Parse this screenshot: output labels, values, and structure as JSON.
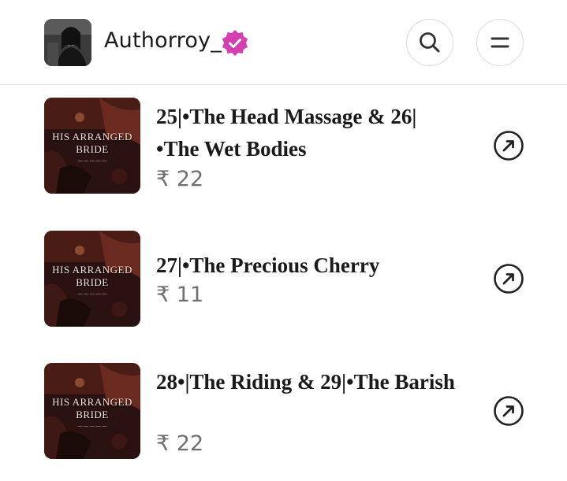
{
  "header": {
    "username": "Authorroy_",
    "verified_icon": "verified-badge-icon",
    "search_icon": "search-icon",
    "menu_icon": "menu-icon",
    "accent_color": "#d63fb0"
  },
  "episodes": [
    {
      "title": "25|•The Head Massage & 26| •The Wet Bodies",
      "price": "₹ 22",
      "cover_title": "HIS ARRANGED BRIDE",
      "action_icon": "open-arrow-icon"
    },
    {
      "title": "27|•The Precious Cherry",
      "price": "₹ 11",
      "cover_title": "HIS ARRANGED BRIDE",
      "action_icon": "open-arrow-icon"
    },
    {
      "title": "28•|The Riding & 29|•The Barish",
      "price": "₹ 22",
      "cover_title": "HIS ARRANGED BRIDE",
      "action_icon": "open-arrow-icon"
    }
  ]
}
